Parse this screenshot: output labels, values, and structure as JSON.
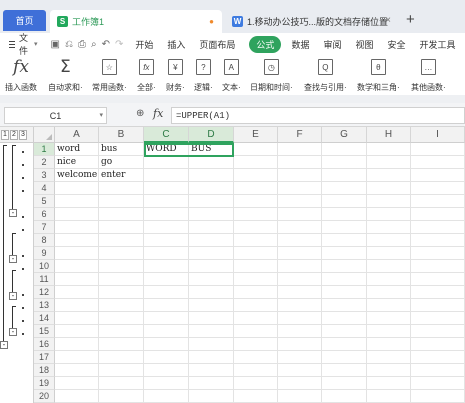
{
  "tabs": {
    "home_label": "首页",
    "active": {
      "icon": "S",
      "label": "工作簿1"
    },
    "other": {
      "icon": "W",
      "label": "1.移动办公技巧...版的文档存储位置"
    },
    "add": "+"
  },
  "menubar": {
    "file_label": "文件",
    "items": [
      {
        "label": "开始",
        "active": false
      },
      {
        "label": "插入",
        "active": false
      },
      {
        "label": "页面布局",
        "active": false
      },
      {
        "label": "公式",
        "active": true
      },
      {
        "label": "数据",
        "active": false
      },
      {
        "label": "审阅",
        "active": false
      },
      {
        "label": "视图",
        "active": false
      },
      {
        "label": "安全",
        "active": false
      },
      {
        "label": "开发工具",
        "active": false
      }
    ]
  },
  "ribbon": {
    "buttons": [
      {
        "icon": "fx",
        "label": "插入函数"
      },
      {
        "icon": "Σ",
        "label": "自动求和·"
      },
      {
        "icon": "☆",
        "label": "常用函数·"
      },
      {
        "icon": "fx",
        "label": "全部·"
      },
      {
        "icon": "¥",
        "label": "财务·"
      },
      {
        "icon": "?",
        "label": "逻辑·"
      },
      {
        "icon": "A",
        "label": "文本·"
      },
      {
        "icon": "◷",
        "label": "日期和时间·"
      },
      {
        "icon": "Q",
        "label": "查找与引用·"
      },
      {
        "icon": "θ",
        "label": "数学和三角·"
      },
      {
        "icon": "…",
        "label": "其他函数·"
      }
    ]
  },
  "formula_bar": {
    "name_box": "C1",
    "fx": "fx",
    "formula": "=UPPER(A1)"
  },
  "grid": {
    "outline_levels": [
      "1",
      "2",
      "3"
    ],
    "columns": [
      "A",
      "B",
      "C",
      "D",
      "E",
      "F",
      "G",
      "H",
      "I"
    ],
    "rows": [
      "1",
      "2",
      "3",
      "4",
      "5",
      "6",
      "7",
      "8",
      "9",
      "10",
      "11",
      "12",
      "13",
      "14",
      "15",
      "16",
      "17",
      "18",
      "19",
      "20"
    ],
    "cells": {
      "A1": "word",
      "B1": "bus",
      "C1": "WORD",
      "D1": "BUS",
      "A2": "nice",
      "B2": "go",
      "A3": "welcome",
      "B3": "enter"
    },
    "selected_range": "C1:D1"
  }
}
